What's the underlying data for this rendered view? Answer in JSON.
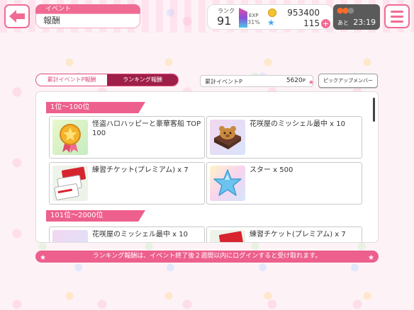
{
  "header": {
    "category_tag": "イベント",
    "title": "報酬"
  },
  "status": {
    "rank_label": "ランク",
    "rank_value": "91",
    "exp_label": "EXP",
    "exp_percent": "31%",
    "coins": "953400",
    "stars": "115",
    "plus_symbol": "+"
  },
  "live_boost": {
    "ato_label": "あと",
    "time_remaining": "23:19"
  },
  "tabs": [
    {
      "label": "累計イベントP報酬",
      "active": false
    },
    {
      "label": "ランキング報酬",
      "active": true
    }
  ],
  "points": {
    "label": "累計イベントP",
    "value": "5620",
    "unit": "P"
  },
  "pickup_button": "ピックアップメンバー",
  "sections": [
    {
      "header": "1位〜100位",
      "rewards": [
        {
          "text": "怪盗ハロハッピーと豪華客船 TOP100",
          "icon": "medal-icon"
        },
        {
          "text": "花咲屋のミッシェル最中 x 10",
          "icon": "michelle-monaka-icon"
        },
        {
          "text": "練習チケット(プレミアム) x 7",
          "icon": "practice-ticket-icon"
        },
        {
          "text": "スター x 500",
          "icon": "star-item-icon"
        }
      ]
    },
    {
      "header": "101位〜2000位",
      "rewards": [
        {
          "text": "花咲屋のミッシェル最中 x 10",
          "icon": "michelle-monaka-icon"
        },
        {
          "text": "練習チケット(プレミアム) x 7",
          "icon": "practice-ticket-icon"
        }
      ]
    }
  ],
  "notice": "ランキング報酬は、イベント終了後２週間以内にログインすると受け取れます。",
  "colors": {
    "accent_pink": "#ed5f8d",
    "active_tab": "#9e1f47",
    "back_border": "#f06b93"
  }
}
